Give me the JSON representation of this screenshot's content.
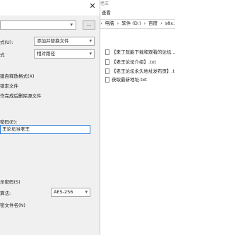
{
  "dialog": {
    "close": "✕",
    "browse_label": "...",
    "update_mode_label": "式(U):",
    "update_mode_value": "添加并替换文件",
    "path_mode_label": "式",
    "path_mode_value": "相对路径",
    "options": [
      "建自释放格式(X)",
      "锁定文件",
      "作完成后删除源文件"
    ],
    "password_label": "密码(E):",
    "password_value": "王论坛当老王",
    "show_password": "示密码(S)",
    "encryption_label": "算法:",
    "encryption_value": "AES-256",
    "encrypt_names": "密文件名(N)"
  },
  "explorer": {
    "title": "老王",
    "menu": "查看",
    "breadcrumb": [
      "电脑",
      "软件 (D:)",
      "百度",
      "s8x.xy"
    ],
    "files": [
      "【来了就能下载和观看的论坛...",
      "【老王论坛介绍】.txt",
      "【老王论坛永久地址发布页】.t",
      "获取最新地址.txt"
    ]
  }
}
